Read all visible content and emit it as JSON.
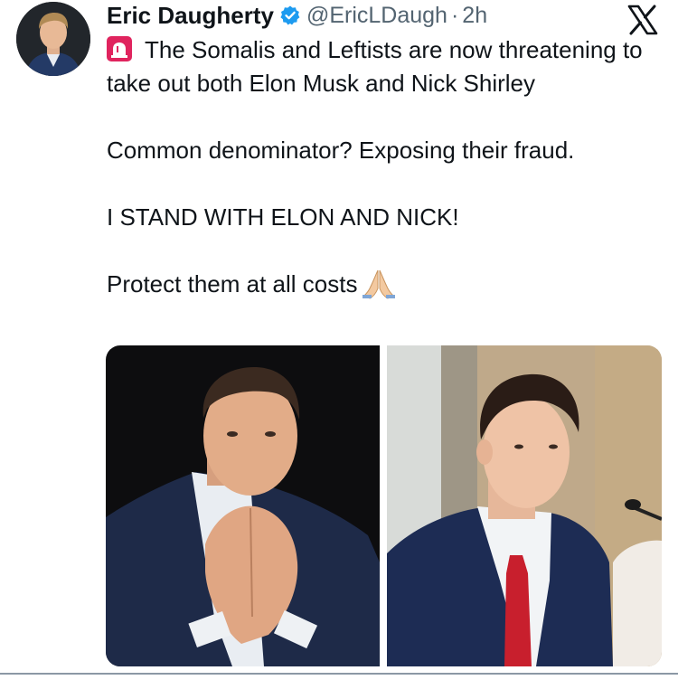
{
  "author": {
    "display_name": "Eric Daugherty",
    "handle": "@EricLDaugh",
    "separator": "·",
    "time": "2h",
    "verified": true,
    "avatar_icon": "profile-photo"
  },
  "platform_icon": "x-logo-icon",
  "tweet": {
    "line1": "The Somalis and Leftists are now threatening to take out both Elon Musk and Nick Shirley",
    "line2": "Common denominator? Exposing their fraud.",
    "line3": "I STAND WITH ELON AND NICK!",
    "line4": "Protect them at all costs",
    "leading_emoji": "rotating-light-icon",
    "trailing_emoji": "folded-hands-icon"
  },
  "colors": {
    "text": "#0f1419",
    "muted": "#536471",
    "verified_blue": "#1d9bf0",
    "alert_red": "#e0245e"
  }
}
